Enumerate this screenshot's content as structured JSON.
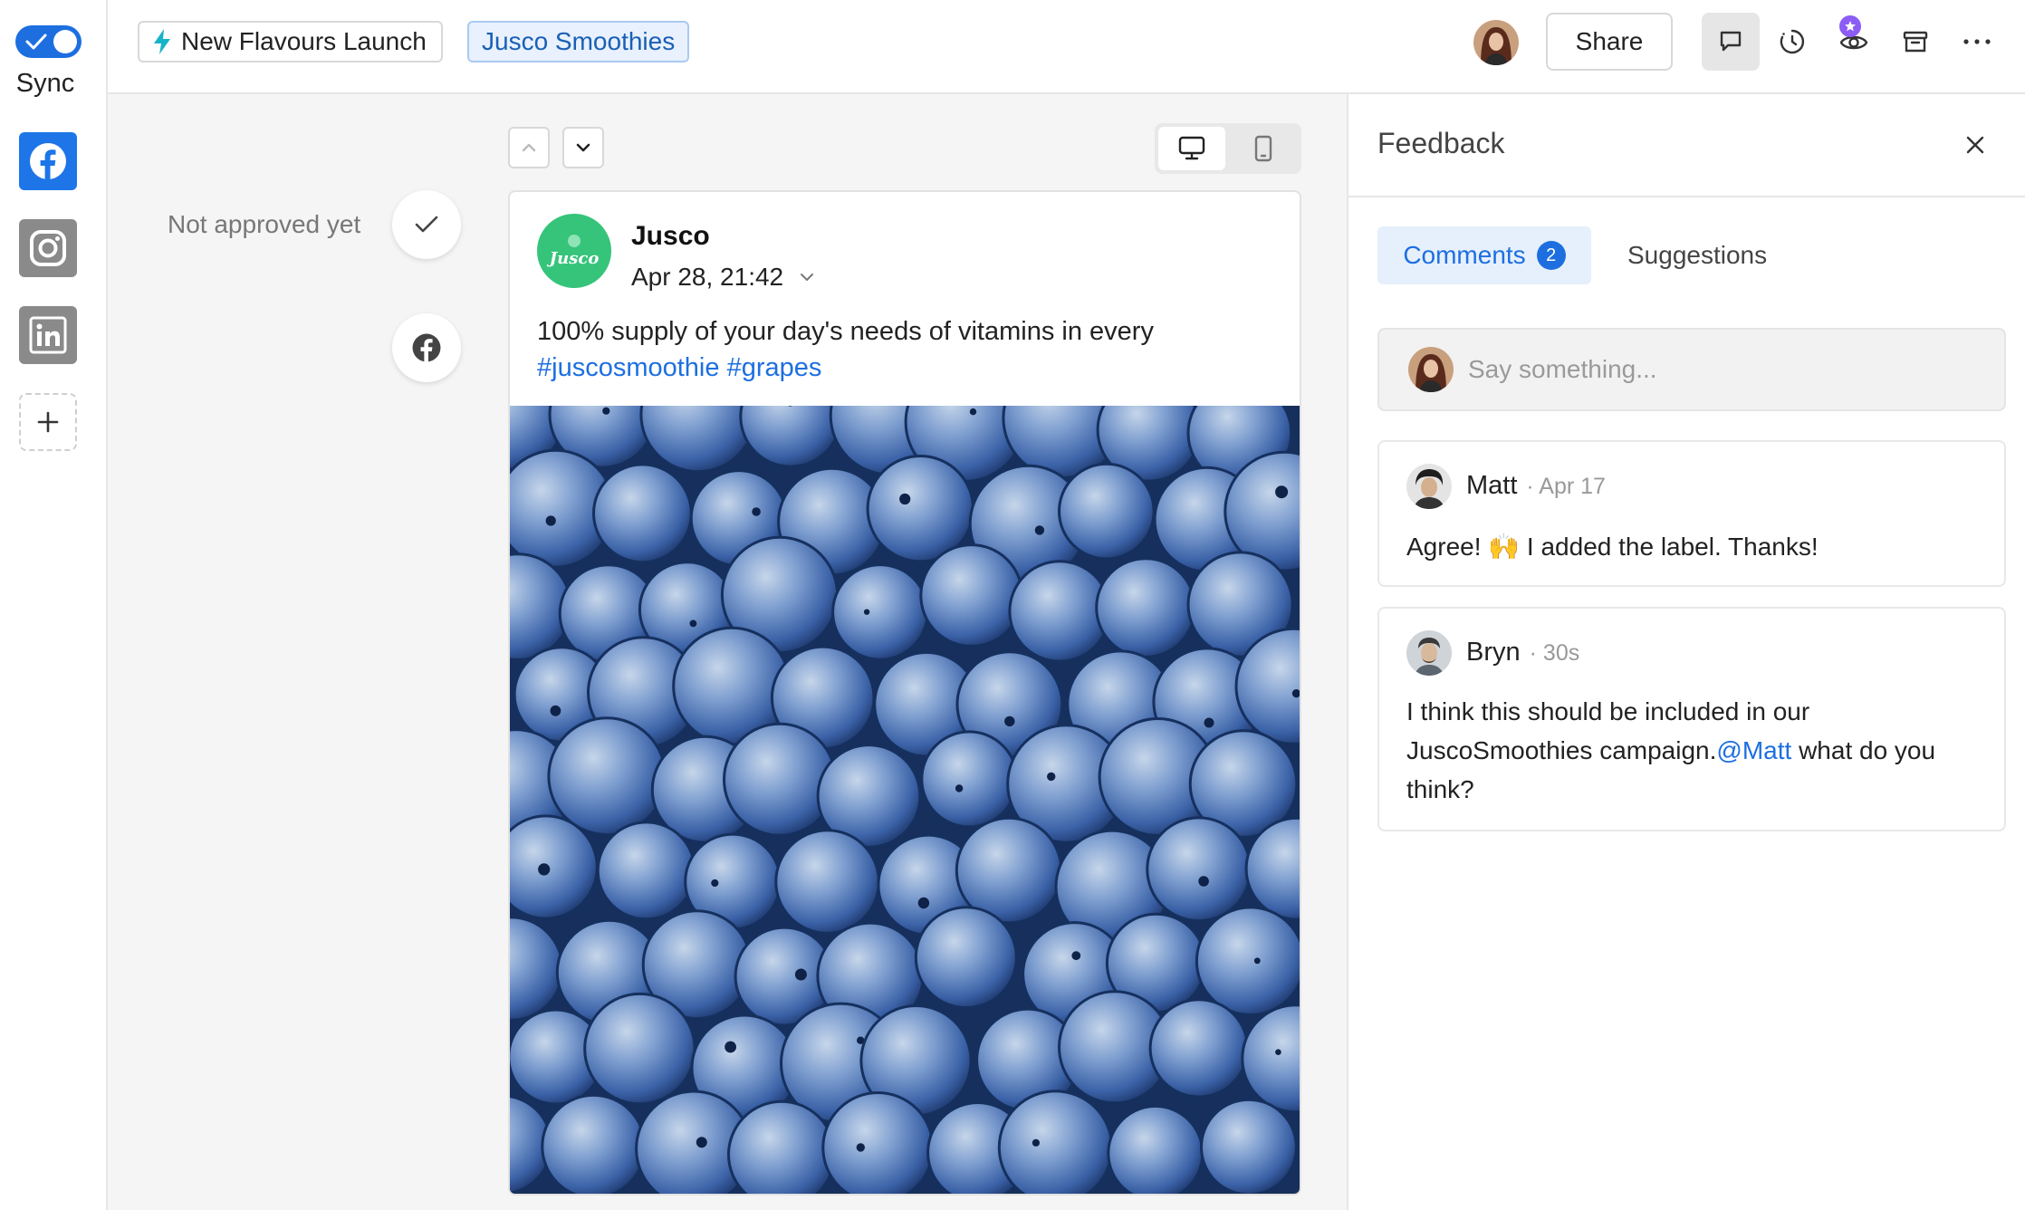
{
  "sidebar": {
    "sync_label": "Sync",
    "sync_enabled": true,
    "networks": [
      {
        "name": "facebook-icon",
        "active": true
      },
      {
        "name": "instagram-icon",
        "active": false
      },
      {
        "name": "linkedin-icon",
        "active": false
      }
    ],
    "add_icon": "plus-icon"
  },
  "topbar": {
    "campaign_label": "New Flavours Launch",
    "brand_label": "Jusco Smoothies",
    "share_label": "Share",
    "tools": [
      "comment-icon",
      "history-icon",
      "eye-icon",
      "archive-icon",
      "more-icon"
    ]
  },
  "main": {
    "approval_status": "Not approved yet",
    "post": {
      "logo_text": "Jusco",
      "author": "Jusco",
      "date": "Apr 28, 21:42",
      "text": "100% supply of your day's needs of vitamins in every",
      "hashtags": [
        "#juscosmoothie",
        "#grapes"
      ]
    }
  },
  "feedback": {
    "title": "Feedback",
    "tabs": {
      "comments_label": "Comments",
      "comments_count": "2",
      "suggestions_label": "Suggestions"
    },
    "input_placeholder": "Say something...",
    "comments": [
      {
        "author": "Matt",
        "time": "· Apr 17",
        "body": "Agree! 🙌 I added the label. Thanks!"
      },
      {
        "author": "Bryn",
        "time": "· 30s",
        "body_before": "I think this should be included in our JuscoSmoothies campaign.",
        "mention": "@Matt",
        "body_after": " what do you think?"
      }
    ]
  },
  "colors": {
    "accent": "#1d6fe0",
    "facebook": "#1d75e8",
    "brand_green": "#35c47a",
    "badge_purple": "#8b5cf6"
  }
}
